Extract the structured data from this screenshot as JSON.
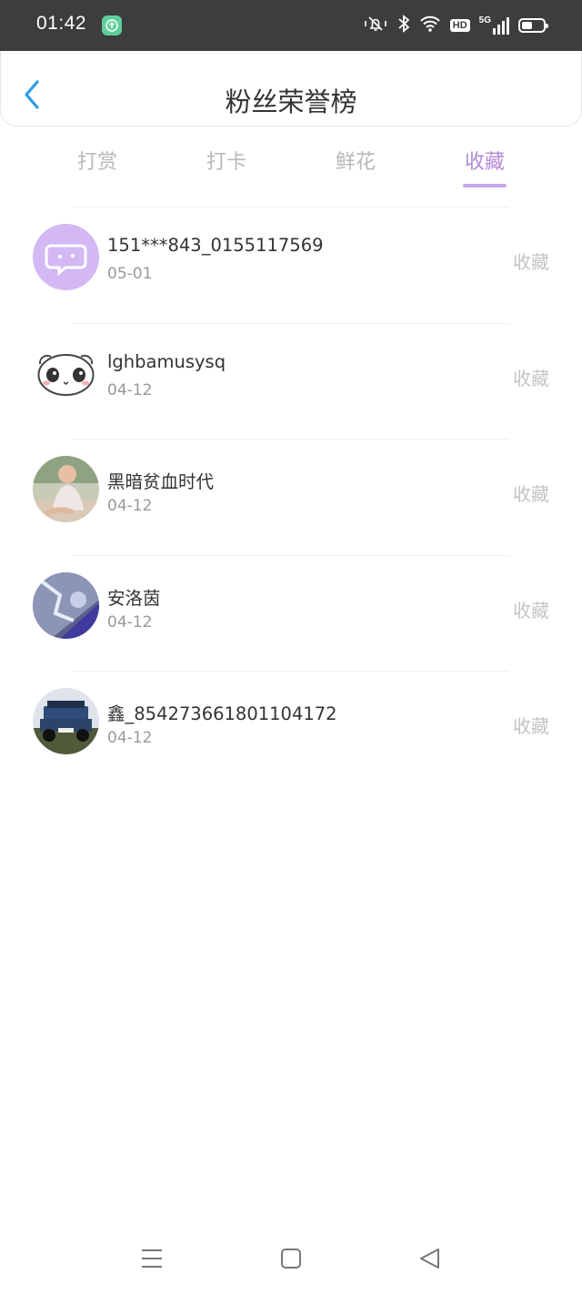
{
  "status_bar": {
    "time": "01:42",
    "icons": [
      "app-update-icon",
      "mute-vibrate-icon",
      "bluetooth-icon",
      "wifi-icon",
      "hd-icon",
      "5g-signal-icon",
      "battery-icon"
    ],
    "hd_label": "HD",
    "network_label": "5G"
  },
  "header": {
    "title": "粉丝荣誉榜",
    "back_icon": "chevron-left-icon",
    "accent_color": "#2b9be8"
  },
  "tabs": [
    {
      "label": "打赏",
      "active": false
    },
    {
      "label": "打卡",
      "active": false
    },
    {
      "label": "鲜花",
      "active": false
    },
    {
      "label": "收藏",
      "active": true
    }
  ],
  "accent_color": "#b38ad9",
  "fans": [
    {
      "name": "151***843_0155117569",
      "date": "05-01",
      "action": "收藏",
      "avatar": "default-chat-avatar"
    },
    {
      "name": "lghbamusysq",
      "date": "04-12",
      "action": "收藏",
      "avatar": "panda-avatar"
    },
    {
      "name": "黑暗贫血时代",
      "date": "04-12",
      "action": "收藏",
      "avatar": "child-photo-avatar"
    },
    {
      "name": "安洛茵",
      "date": "04-12",
      "action": "收藏",
      "avatar": "anime-avatar"
    },
    {
      "name": "鑫_854273661801104172",
      "date": "04-12",
      "action": "收藏",
      "avatar": "jeep-avatar"
    }
  ],
  "nav_bar": {
    "icons": [
      "menu-icon",
      "home-square-icon",
      "back-triangle-icon"
    ]
  }
}
